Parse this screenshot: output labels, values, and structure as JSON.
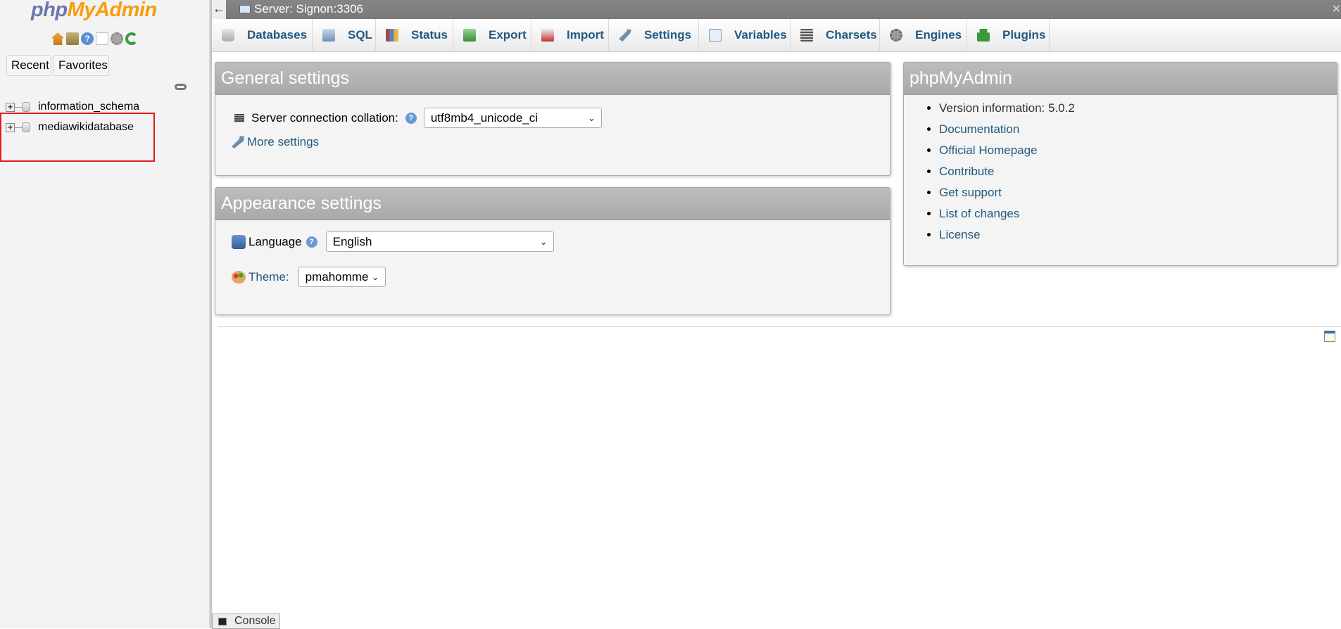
{
  "nav": {
    "logo": {
      "php": "php",
      "myadmin": "MyAdmin"
    },
    "icons": [
      "home-icon",
      "query-window-icon",
      "help-icon",
      "documentation-icon",
      "settings-gear-icon",
      "reload-icon"
    ],
    "tabs": {
      "recent": "Recent",
      "favorites": "Favorites"
    },
    "databases": [
      {
        "name": "information_schema"
      },
      {
        "name": "mediawikidatabase"
      }
    ]
  },
  "serverbar": {
    "back": "←",
    "label": "Server: Signon:3306"
  },
  "topmenu": {
    "tabs": [
      {
        "label": "Databases",
        "icon": "database-icon"
      },
      {
        "label": "SQL",
        "icon": "sql-icon"
      },
      {
        "label": "Status",
        "icon": "status-icon"
      },
      {
        "label": "Export",
        "icon": "export-icon"
      },
      {
        "label": "Import",
        "icon": "import-icon"
      },
      {
        "label": "Settings",
        "icon": "wrench-icon"
      },
      {
        "label": "Variables",
        "icon": "variables-icon"
      },
      {
        "label": "Charsets",
        "icon": "charsets-icon"
      },
      {
        "label": "Engines",
        "icon": "engines-icon"
      },
      {
        "label": "Plugins",
        "icon": "plugins-icon"
      }
    ]
  },
  "general": {
    "title": "General settings",
    "collation_label": "Server connection collation:",
    "collation_value": "utf8mb4_unicode_ci",
    "more_settings": "More settings"
  },
  "appearance": {
    "title": "Appearance settings",
    "language_label": "Language",
    "language_value": "English",
    "theme_label": "Theme:",
    "theme_value": "pmahomme"
  },
  "pma": {
    "title": "phpMyAdmin",
    "version": "Version information: 5.0.2",
    "links": [
      "Documentation",
      "Official Homepage",
      "Contribute",
      "Get support",
      "List of changes",
      "License"
    ]
  },
  "console": {
    "label": "Console"
  },
  "colors": {
    "link": "#235a81",
    "accent": "#f89c0e",
    "header_gray": "#a9a9a9",
    "highlight_box": "#e41c1c"
  }
}
